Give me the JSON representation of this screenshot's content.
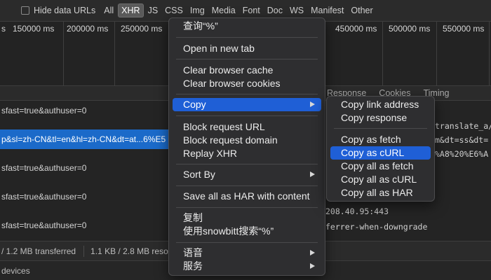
{
  "filter_bar": {
    "hide_data_urls_label": "Hide data URLs",
    "types": [
      {
        "label": "All",
        "selected": false
      },
      {
        "label": "XHR",
        "selected": true
      },
      {
        "label": "JS",
        "selected": false
      },
      {
        "label": "CSS",
        "selected": false
      },
      {
        "label": "Img",
        "selected": false
      },
      {
        "label": "Media",
        "selected": false
      },
      {
        "label": "Font",
        "selected": false
      },
      {
        "label": "Doc",
        "selected": false
      },
      {
        "label": "WS",
        "selected": false
      },
      {
        "label": "Manifest",
        "selected": false
      },
      {
        "label": "Other",
        "selected": false
      }
    ]
  },
  "timeline": {
    "ticks": [
      "s",
      "150000 ms",
      "200000 ms",
      "250000 ms",
      "450000 ms",
      "500000 ms",
      "550000 ms"
    ]
  },
  "detail_tabs": [
    "Response",
    "Cookies",
    "Timing"
  ],
  "requests": [
    {
      "text": "sfast=true&authuser=0",
      "selected": false
    },
    {
      "text": "p&sl=zh-CN&tl=en&hl=zh-CN&dt=at...6%E5",
      "selected": true
    },
    {
      "text": "sfast=true&authuser=0",
      "selected": false
    },
    {
      "text": "sfast=true&authuser=0",
      "selected": false
    },
    {
      "text": "sfast=true&authuser=0",
      "selected": false
    }
  ],
  "detail_lines": [
    "translate_a/",
    "m&dt=ss&dt=",
    "%A8%20%E6%A",
    "208.40.95:443",
    "ferrer-when-downgrade"
  ],
  "status_bar": {
    "transferred": "/ 1.2 MB transferred",
    "resources": "1.1 KB / 2.8 MB reso"
  },
  "drawer": {
    "label": "devices"
  },
  "context_menu": {
    "items": {
      "query": "查询“%”",
      "open_new_tab": "Open in new tab",
      "clear_cache": "Clear browser cache",
      "clear_cookies": "Clear browser cookies",
      "copy": "Copy",
      "block_url": "Block request URL",
      "block_domain": "Block request domain",
      "replay_xhr": "Replay XHR",
      "sort_by": "Sort By",
      "save_har": "Save all as HAR with content",
      "copy_zh": "复制",
      "search_snowbitt": "使用snowbitt搜索“%”",
      "voice": "语音",
      "services": "服务"
    }
  },
  "copy_submenu": {
    "items": {
      "copy_link": "Copy link address",
      "copy_response": "Copy response",
      "copy_fetch": "Copy as fetch",
      "copy_curl": "Copy as cURL",
      "copy_all_fetch": "Copy all as fetch",
      "copy_all_curl": "Copy all as cURL",
      "copy_all_har": "Copy all as HAR"
    }
  },
  "colors": {
    "highlight": "#1f5fd6",
    "selected_row": "#1b6ac9"
  }
}
